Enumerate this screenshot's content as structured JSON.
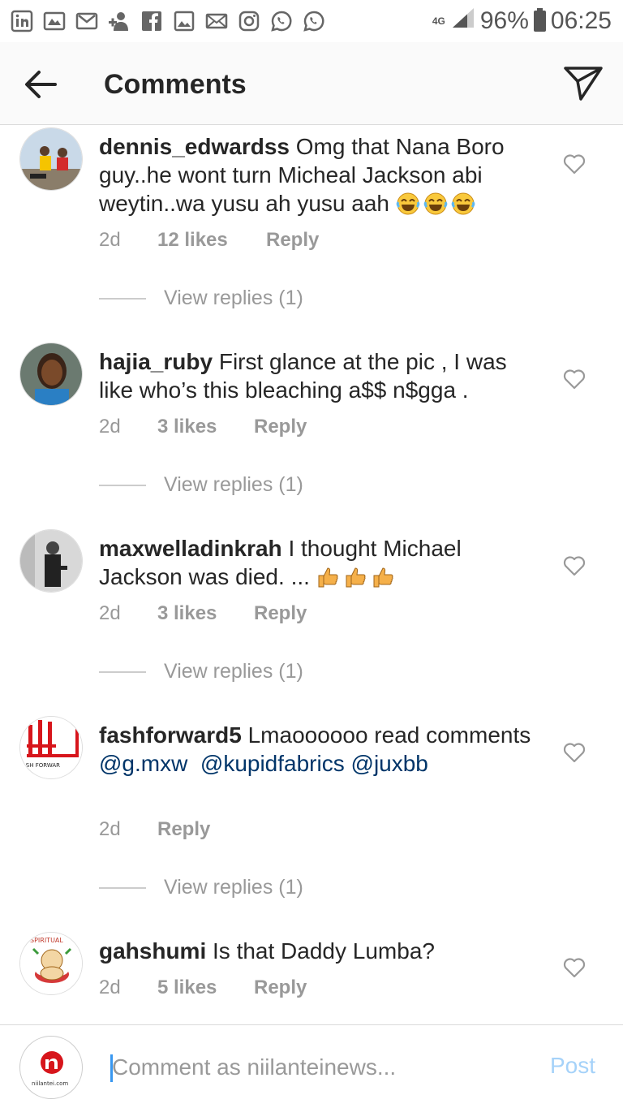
{
  "status_bar": {
    "icons": [
      "linkedin-icon",
      "gallery-icon",
      "gmail-icon",
      "add-person-icon",
      "facebook-icon",
      "image-icon",
      "mail-icon",
      "instagram-icon",
      "whatsapp-icon",
      "whatsapp-icon"
    ],
    "network": "4G",
    "battery": "96%",
    "time": "06:25"
  },
  "header": {
    "title": "Comments"
  },
  "comments": [
    {
      "username": "dennis_edwardss",
      "text": "Omg that Nana Boro guy..he wont turn Micheal Jackson abi weytin..wa yusu ah yusu aah",
      "emoji": "laughing-emoji",
      "time": "2d",
      "likes": "12 likes",
      "reply": "Reply",
      "view_replies": "View replies (1)"
    },
    {
      "username": "hajia_ruby",
      "text": "First glance at the pic , I was like who’s this bleaching a$$ n$gga .",
      "time": "2d",
      "likes": "3 likes",
      "reply": "Reply",
      "view_replies": "View replies (1)"
    },
    {
      "username": "maxwelladinkrah",
      "text": "I thought Michael Jackson was died. ...",
      "emoji": "thumbs-up-emoji",
      "time": "2d",
      "likes": "3 likes",
      "reply": "Reply",
      "view_replies": "View replies (1)"
    },
    {
      "username": "fashforward5",
      "text": "Lmaoooooo read comments",
      "mentions": [
        "@g.mxw",
        "@kupidfabrics",
        "@juxbb"
      ],
      "time": "2d",
      "reply": "Reply",
      "view_replies": "View replies (1)",
      "avatar_text": "ASH FORWAR"
    },
    {
      "username": "gahshumi",
      "text": "Is that Daddy Lumba?",
      "time": "2d",
      "likes": "5 likes",
      "reply": "Reply",
      "avatar_text": "SPIRITUAL"
    }
  ],
  "composer": {
    "placeholder": "Comment as niilanteinews...",
    "post_label": "Post",
    "avatar_text": "niilantei.com"
  },
  "colors": {
    "mention": "#003569",
    "meta": "#999999",
    "post_disabled": "#a5d2f9",
    "header_bg": "#fafafa"
  }
}
